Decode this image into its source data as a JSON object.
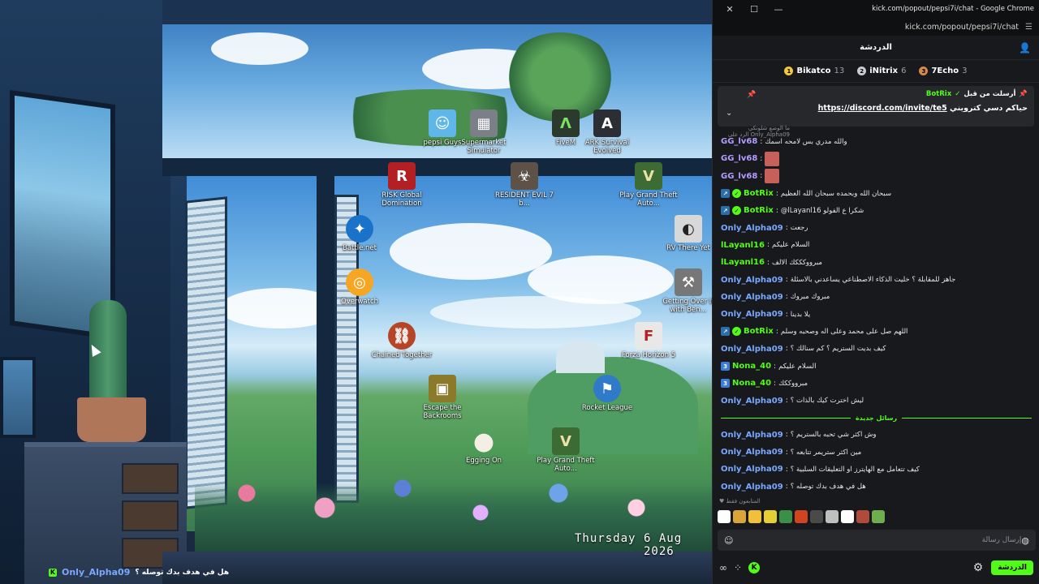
{
  "window": {
    "title": "kick.com/popout/pepsi7i/chat - Google Chrome",
    "url": "kick.com/popout/pepsi7i/chat",
    "close_glyph": "✕",
    "maximize_glyph": "☐",
    "minimize_glyph": "—"
  },
  "desktop": {
    "date_day": "Thursday",
    "date": "6 Aug 2026",
    "icons": [
      {
        "label": "pepsi Guys",
        "glyph": "☺",
        "color": "#5fb6e8"
      },
      {
        "label": "Supermarket Simulator",
        "glyph": "▦",
        "color": "#7a7f88"
      },
      {
        "label": "FiveM",
        "glyph": "Λ",
        "color": "#2c3a2e"
      },
      {
        "label": "ARK Survival Evolved",
        "glyph": "A",
        "color": "#2b2f35"
      },
      {
        "label": "RISK Global Domination",
        "glyph": "R",
        "color": "#b32024"
      },
      {
        "label": "RESIDENT EVIL 7 b...",
        "glyph": "☣",
        "color": "#5d5148"
      },
      {
        "label": "Play Grand Theft Auto...",
        "glyph": "V",
        "color": "#3c6b33"
      },
      {
        "label": "Battle.net",
        "glyph": "✦",
        "color": "#1a73c9"
      },
      {
        "label": "RV There Yet",
        "glyph": "◐",
        "color": "#d8d8d8"
      },
      {
        "label": "Overwatch",
        "glyph": "◎",
        "color": "#f5a623"
      },
      {
        "label": "Getting Over It with Ben...",
        "glyph": "⚒",
        "color": "#777777"
      },
      {
        "label": "Chained Together",
        "glyph": "⛓",
        "color": "#b64528"
      },
      {
        "label": "Forza Horizon 5",
        "glyph": "F",
        "color": "#e8e8e8"
      },
      {
        "label": "Escape the Backrooms",
        "glyph": "▣",
        "color": "#8a7a2a"
      },
      {
        "label": "Rocket League",
        "glyph": "⚑",
        "color": "#2f7ac9"
      },
      {
        "label": "Egging On",
        "glyph": "●",
        "color": "#f3efe5"
      },
      {
        "label": "Play Grand Theft Auto...",
        "glyph": "V",
        "color": "#3c6b33"
      }
    ]
  },
  "overlay": {
    "user": "Only_Alpha09",
    "text": "هل في هدف بدك توصله ؟"
  },
  "chat": {
    "header_title": "الدردشة",
    "leaderboard": [
      {
        "name": "Bikatco",
        "count": "13",
        "rank": "1",
        "color": "#f3c63f"
      },
      {
        "name": "iNitrix",
        "count": "6",
        "rank": "2",
        "color": "#c9ccd1"
      },
      {
        "name": "7Echo",
        "count": "3",
        "rank": "3",
        "color": "#d38a4a"
      }
    ],
    "pinned": {
      "sent_by": "أرسلت من قبل",
      "bot_name": "BotRix",
      "prefix": "حياكم دسي كترويني",
      "link": "https://discord.com/invite/te5"
    },
    "reply_hint": "ما الوضع شلونكي Only_Alpha09 الرد على",
    "messages": [
      {
        "user": "GG_lv68",
        "color": "#b39cff",
        "text": "والله مدري بس لامحه اسمك",
        "badges": [],
        "emote": ""
      },
      {
        "user": "GG_lv68",
        "color": "#b39cff",
        "text": "",
        "badges": [],
        "emote": "#c7605a"
      },
      {
        "user": "GG_lv68",
        "color": "#b39cff",
        "text": "",
        "badges": [],
        "emote": "#c7605a"
      },
      {
        "user": "BotRix",
        "color": "#53fc18",
        "text": "سبحان الله وبحمده سبحان الله العظيم",
        "badges": [
          "bot",
          "verified"
        ],
        "emote": ""
      },
      {
        "user": "BotRix",
        "color": "#53fc18",
        "text": "@lLayanl16 شكرا ع الفولو",
        "badges": [
          "bot",
          "verified"
        ],
        "emote": ""
      },
      {
        "user": "Only_Alpha09",
        "color": "#7aa7ff",
        "text": "رجعت",
        "badges": [],
        "emote": ""
      },
      {
        "user": "lLayanl16",
        "color": "#53fc18",
        "text": "السلام عليكم",
        "badges": [],
        "emote": ""
      },
      {
        "user": "lLayanl16",
        "color": "#53fc18",
        "text": "مبرووكككك الالف",
        "badges": [],
        "emote": ""
      },
      {
        "user": "Only_Alpha09",
        "color": "#7aa7ff",
        "text": "جاهز للمقابلة ؟ خليت الذكاء الاصطناعي يساعدني بالاسئلة",
        "badges": [],
        "emote": ""
      },
      {
        "user": "Only_Alpha09",
        "color": "#7aa7ff",
        "text": "مبروك مبروك",
        "badges": [],
        "emote": ""
      },
      {
        "user": "Only_Alpha09",
        "color": "#7aa7ff",
        "text": "يلا بدينا",
        "badges": [],
        "emote": ""
      },
      {
        "user": "BotRix",
        "color": "#53fc18",
        "text": "اللهم صل على محمد وعلى اله وصحبه وسلم",
        "badges": [
          "bot",
          "verified"
        ],
        "emote": ""
      },
      {
        "user": "Only_Alpha09",
        "color": "#7aa7ff",
        "text": "كيف بديت الستريم ؟ كم سنالك ؟",
        "badges": [],
        "emote": ""
      },
      {
        "user": "Nona_40",
        "color": "#53fc18",
        "text": "السلام عليكم",
        "badges": [
          "sub"
        ],
        "emote": ""
      },
      {
        "user": "Nona_40",
        "color": "#53fc18",
        "text": "مبرووككك",
        "badges": [
          "sub"
        ],
        "emote": ""
      },
      {
        "user": "Only_Alpha09",
        "color": "#7aa7ff",
        "text": "ليش اخترت كيك بالذات ؟",
        "badges": [],
        "emote": ""
      }
    ],
    "new_messages_label": "رسائل جديدة",
    "new_messages": [
      {
        "user": "Only_Alpha09",
        "color": "#7aa7ff",
        "text": "وش اكثر شي تحبه بالستريم ؟"
      },
      {
        "user": "Only_Alpha09",
        "color": "#7aa7ff",
        "text": "مين اكثر ستريمر تتابعه ؟"
      },
      {
        "user": "Only_Alpha09",
        "color": "#7aa7ff",
        "text": "كيف تتعامل مع الهايترز او التعليقات السلبية ؟"
      },
      {
        "user": "Only_Alpha09",
        "color": "#7aa7ff",
        "text": "هل في هدف بدك توصله ؟"
      }
    ],
    "emote_section_title": "♥ المتابعون فقط",
    "emotes": [
      "#ffffff",
      "#d9a53b",
      "#f0c03a",
      "#e5d033",
      "#3c8f46",
      "#d0451f",
      "#4a4a4a",
      "#bfbfbf",
      "#ffffff",
      "#b04b3a",
      "#6fae4f"
    ],
    "input_placeholder": "إرسال رسالة",
    "send_label": "الدردشة",
    "accent": "#53fc18"
  }
}
